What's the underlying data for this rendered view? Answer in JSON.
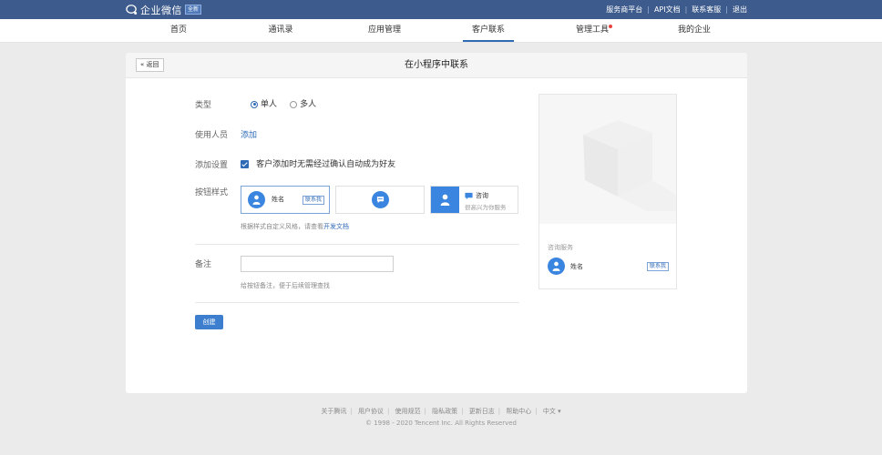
{
  "topbar": {
    "logo_text": "企业微信",
    "logo_badge": "全新",
    "links": [
      "服务商平台",
      "API文档",
      "联系客服",
      "退出"
    ]
  },
  "nav": {
    "items": [
      "首页",
      "通讯录",
      "应用管理",
      "客户联系",
      "管理工具",
      "我的企业"
    ],
    "active_index": 3
  },
  "panel": {
    "back_label": "返回",
    "title": "在小程序中联系",
    "type": {
      "label": "类型",
      "options": [
        "单人",
        "多人"
      ],
      "selected": "单人"
    },
    "users": {
      "label": "使用人员",
      "add_link": "添加"
    },
    "add_setting": {
      "label": "添加设置",
      "checkbox_text": "客户添加时无需经过确认自动成为好友",
      "checked": true
    },
    "button_style": {
      "label": "按钮样式",
      "card1": {
        "name": "姓名",
        "badge": "联系我"
      },
      "card3": {
        "title": "咨询",
        "subtitle": "很高兴为你服务"
      },
      "hint_prefix": "根据样式自定义风格，请查看",
      "hint_link": "开发文档"
    },
    "remark": {
      "label": "备注",
      "value": "",
      "hint": "给按钮备注，便于后续管理查找"
    },
    "create_button": "创建",
    "preview": {
      "section_label": "咨询服务",
      "name": "姓名",
      "badge": "联系我"
    }
  },
  "footer": {
    "links": [
      "关于腾讯",
      "用户协议",
      "使用规范",
      "隐私政策",
      "更新日志",
      "帮助中心",
      "中文 ▾"
    ],
    "copyright": "© 1998 - 2020 Tencent Inc. All Rights Reserved"
  },
  "colors": {
    "topbar": "#3d5b8c",
    "accent": "#2f6bb5",
    "avatar": "#3a85e0",
    "notification_dot": "#e64340"
  }
}
